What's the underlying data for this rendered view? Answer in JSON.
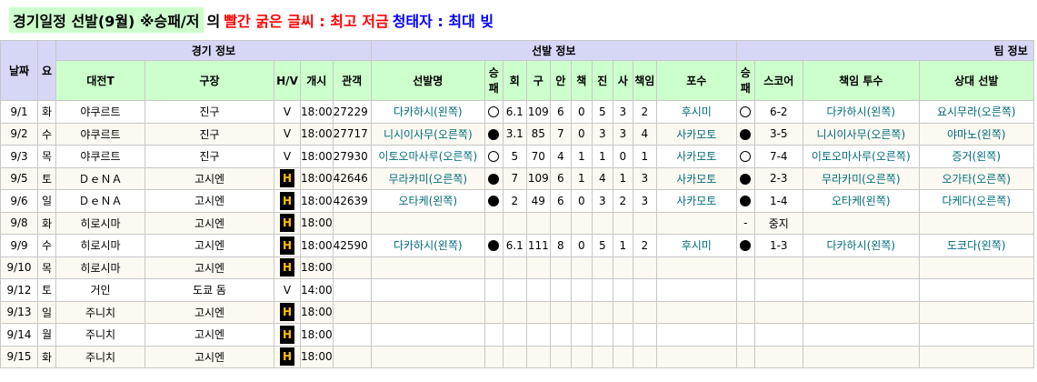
{
  "title": {
    "main": "경기일정 선발(9월) ※승패/저",
    "connector": "의",
    "red_part": "빨간 굵은 글씨 : 최고 저금",
    "blue_part": "청태자 : 최대 빚"
  },
  "groups": {
    "date": "날짜",
    "day": "요",
    "game_info": "경기 정보",
    "starter_info": "선발 정보",
    "team_info": "팀 정보"
  },
  "headers": {
    "opponent": "대전T",
    "stadium": "구장",
    "hv": "H/V",
    "start": "개시",
    "attendance": "관객",
    "starter": "선발명",
    "sp_result": "승패",
    "innings": "회",
    "pitches": "구",
    "hits": "안",
    "runs": "책",
    "walks": "진",
    "strikeouts": "사",
    "er": "책임",
    "catcher": "포수",
    "team_result": "승패",
    "score": "스코어",
    "responsible": "책임 투수",
    "opp_starter": "상대 선발"
  },
  "rows": [
    {
      "date": "9/1",
      "day": "화",
      "opp": "야쿠르트",
      "stadium": "진구",
      "hv": "V",
      "start": "18:00",
      "att": "27229",
      "starter": "다카하시(왼쪽)",
      "spr": "W",
      "inn": "6.1",
      "pc": "109",
      "h": "6",
      "r": "0",
      "bb": "5",
      "k": "3",
      "er": "2",
      "catcher": "후시미",
      "tr": "W",
      "score": "6-2",
      "resp": "다카하시(왼쪽)",
      "oppsp": "요시무라(오른쪽)"
    },
    {
      "date": "9/2",
      "day": "수",
      "opp": "야쿠르트",
      "stadium": "진구",
      "hv": "V",
      "start": "18:00",
      "att": "27717",
      "starter": "니시이사무(오른쪽)",
      "spr": "L",
      "inn": "3.1",
      "pc": "85",
      "h": "7",
      "r": "0",
      "bb": "3",
      "k": "3",
      "er": "4",
      "catcher": "사카모토",
      "tr": "L",
      "score": "3-5",
      "resp": "니시이사무(오른쪽)",
      "oppsp": "야마노(왼쪽)"
    },
    {
      "date": "9/3",
      "day": "목",
      "opp": "야쿠르트",
      "stadium": "진구",
      "hv": "V",
      "start": "18:00",
      "att": "27930",
      "starter": "이토오마사루(오른쪽)",
      "spr": "W",
      "inn": "5",
      "pc": "70",
      "h": "4",
      "r": "1",
      "bb": "1",
      "k": "0",
      "er": "1",
      "catcher": "사카모토",
      "tr": "W",
      "score": "7-4",
      "resp": "이토오마사루(오른쪽)",
      "oppsp": "증거(왼쪽)"
    },
    {
      "date": "9/5",
      "day": "토",
      "opp": "ＤｅＮＡ",
      "stadium": "고시엔",
      "hv": "H",
      "start": "18:00",
      "att": "42646",
      "starter": "무라카미(오른쪽)",
      "spr": "L",
      "inn": "7",
      "pc": "109",
      "h": "6",
      "r": "1",
      "bb": "4",
      "k": "1",
      "er": "3",
      "catcher": "사카모토",
      "tr": "L",
      "score": "2-3",
      "resp": "무라카미(오른쪽)",
      "oppsp": "오가타(오른쪽)"
    },
    {
      "date": "9/6",
      "day": "일",
      "opp": "ＤｅＮＡ",
      "stadium": "고시엔",
      "hv": "H",
      "start": "18:00",
      "att": "42639",
      "starter": "오타케(왼쪽)",
      "spr": "L",
      "inn": "2",
      "pc": "49",
      "h": "6",
      "r": "0",
      "bb": "3",
      "k": "2",
      "er": "3",
      "catcher": "사카모토",
      "tr": "L",
      "score": "1-4",
      "resp": "오타케(왼쪽)",
      "oppsp": "다케다(오른쪽)"
    },
    {
      "date": "9/8",
      "day": "화",
      "opp": "히로시마",
      "stadium": "고시엔",
      "hv": "H",
      "start": "18:00",
      "att": "",
      "starter": "",
      "spr": "",
      "inn": "",
      "pc": "",
      "h": "",
      "r": "",
      "bb": "",
      "k": "",
      "er": "",
      "catcher": "",
      "tr": "-",
      "score": "중지",
      "resp": "",
      "oppsp": ""
    },
    {
      "date": "9/9",
      "day": "수",
      "opp": "히로시마",
      "stadium": "고시엔",
      "hv": "H",
      "start": "18:00",
      "att": "42590",
      "starter": "다카하시(왼쪽)",
      "spr": "L",
      "inn": "6.1",
      "pc": "111",
      "h": "8",
      "r": "0",
      "bb": "5",
      "k": "1",
      "er": "2",
      "catcher": "후시미",
      "tr": "L",
      "score": "1-3",
      "resp": "다카하시(왼쪽)",
      "oppsp": "도코다(왼쪽)"
    },
    {
      "date": "9/10",
      "day": "목",
      "opp": "히로시마",
      "stadium": "고시엔",
      "hv": "H",
      "start": "18:00",
      "att": "",
      "starter": "",
      "spr": "",
      "inn": "",
      "pc": "",
      "h": "",
      "r": "",
      "bb": "",
      "k": "",
      "er": "",
      "catcher": "",
      "tr": "",
      "score": "",
      "resp": "",
      "oppsp": ""
    },
    {
      "date": "9/12",
      "day": "토",
      "opp": "거인",
      "stadium": "도쿄 돔",
      "hv": "V",
      "start": "14:00",
      "att": "",
      "starter": "",
      "spr": "",
      "inn": "",
      "pc": "",
      "h": "",
      "r": "",
      "bb": "",
      "k": "",
      "er": "",
      "catcher": "",
      "tr": "",
      "score": "",
      "resp": "",
      "oppsp": ""
    },
    {
      "date": "9/13",
      "day": "일",
      "opp": "주니치",
      "stadium": "고시엔",
      "hv": "H",
      "start": "18:00",
      "att": "",
      "starter": "",
      "spr": "",
      "inn": "",
      "pc": "",
      "h": "",
      "r": "",
      "bb": "",
      "k": "",
      "er": "",
      "catcher": "",
      "tr": "",
      "score": "",
      "resp": "",
      "oppsp": ""
    },
    {
      "date": "9/14",
      "day": "월",
      "opp": "주니치",
      "stadium": "고시엔",
      "hv": "H",
      "start": "18:00",
      "att": "",
      "starter": "",
      "spr": "",
      "inn": "",
      "pc": "",
      "h": "",
      "r": "",
      "bb": "",
      "k": "",
      "er": "",
      "catcher": "",
      "tr": "",
      "score": "",
      "resp": "",
      "oppsp": ""
    },
    {
      "date": "9/15",
      "day": "화",
      "opp": "주니치",
      "stadium": "고시엔",
      "hv": "H",
      "start": "18:00",
      "att": "",
      "starter": "",
      "spr": "",
      "inn": "",
      "pc": "",
      "h": "",
      "r": "",
      "bb": "",
      "k": "",
      "er": "",
      "catcher": "",
      "tr": "",
      "score": "",
      "resp": "",
      "oppsp": ""
    }
  ]
}
